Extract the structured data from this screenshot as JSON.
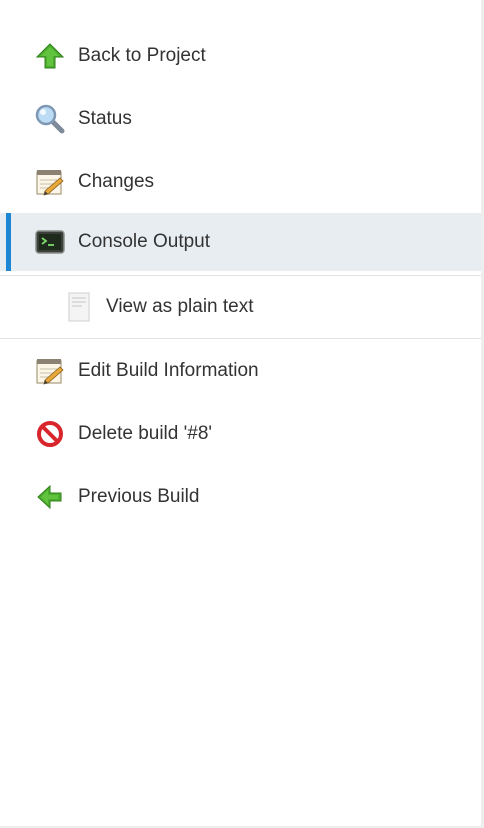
{
  "side_panel": {
    "tasks": [
      {
        "label": "Back to Project",
        "icon": "up-arrow-icon"
      },
      {
        "label": "Status",
        "icon": "magnifier-icon"
      },
      {
        "label": "Changes",
        "icon": "notepad-icon"
      },
      {
        "label": "Console Output",
        "icon": "terminal-icon",
        "active": true
      },
      {
        "label": "View as plain text",
        "icon": "document-icon",
        "subtask": true
      },
      {
        "label": "Edit Build Information",
        "icon": "notepad-icon"
      },
      {
        "label": "Delete build '#8'",
        "icon": "no-entry-icon"
      },
      {
        "label": "Previous Build",
        "icon": "left-arrow-icon"
      }
    ]
  },
  "colors": {
    "active_background": "#e8edf1",
    "active_indicator": "#1e86d2",
    "arrow_green": "#4caf2f",
    "delete_red": "#d9262d",
    "text": "#333333"
  }
}
